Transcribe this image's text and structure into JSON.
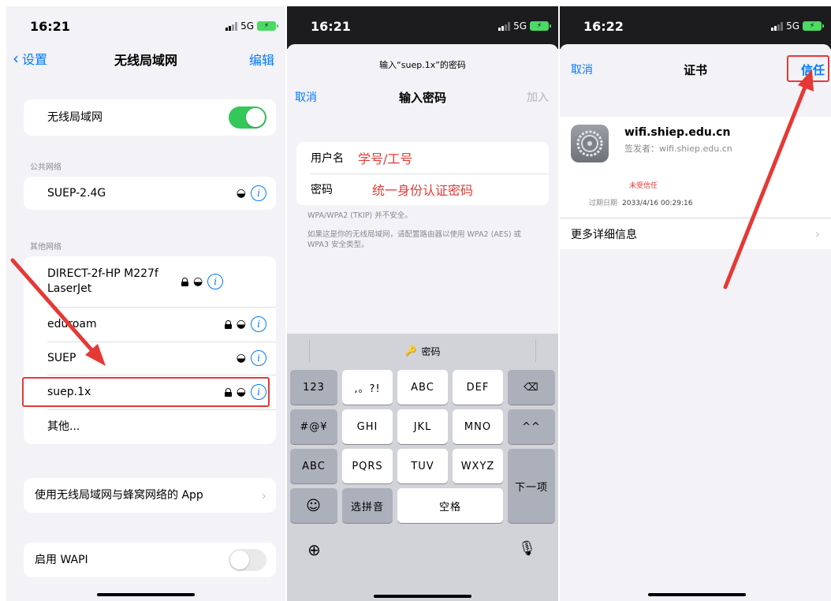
{
  "screen1": {
    "time": "16:21",
    "network": "5G",
    "back_label": "设置",
    "title": "无线局域网",
    "edit_label": "编辑",
    "wifi_label": "无线局域网",
    "wifi_on": true,
    "public_networks_header": "公共网络",
    "public_networks": [
      {
        "name": "SUEP-2.4G",
        "secured": false
      }
    ],
    "other_networks_header": "其他网络",
    "other_networks": [
      {
        "name": "DIRECT-2f-HP M227f LaserJet",
        "secured": true
      },
      {
        "name": "eduroam",
        "secured": true
      },
      {
        "name": "SUEP",
        "secured": false
      },
      {
        "name": "suep.1x",
        "secured": true,
        "highlighted": true
      }
    ],
    "other_label": "其他...",
    "apps_row_label": "使用无线局域网与蜂窝网络的 App",
    "wapi_label": "启用 WAPI",
    "wapi_on": false,
    "info_glyph": "i"
  },
  "screen2": {
    "time": "16:21",
    "network": "5G",
    "prompt": "输入“suep.1x”的密码",
    "cancel_label": "取消",
    "title": "输入密码",
    "join_label": "加入",
    "username_label": "用户名",
    "username_value": "学号/工号",
    "password_label": "密码",
    "password_value": "统一身份认证密码",
    "warning": "WPA/WPA2 (TKIP) 并不安全。",
    "advice": "如果这是你的无线局域网，请配置路由器以使用 WPA2 (AES) 或 WPA3 安全类型。",
    "keyboard": {
      "suggestion": "密码",
      "row1": [
        "123",
        ",。?!",
        "ABC",
        "DEF"
      ],
      "row2": [
        "#@¥",
        "GHI",
        "JKL",
        "MNO",
        "^^"
      ],
      "row3": [
        "ABC",
        "PQRS",
        "TUV",
        "WXYZ"
      ],
      "row4_pinyin": "选拼音",
      "row4_space": "空格",
      "next_label": "下一项"
    }
  },
  "screen3": {
    "time": "16:22",
    "network": "5G",
    "cancel_label": "取消",
    "title": "证书",
    "trust_label": "信任",
    "cert_name": "wifi.shiep.edu.cn",
    "issuer": "签发者：wifi.shiep.edu.cn",
    "status": "未受信任",
    "expiry_label": "过期日期",
    "expiry_value": "2033/4/16 00:29:16",
    "more_details_label": "更多详细信息"
  },
  "colors": {
    "accent": "#007aff",
    "annotation": "#e53935",
    "toggle_on": "#34c759"
  }
}
